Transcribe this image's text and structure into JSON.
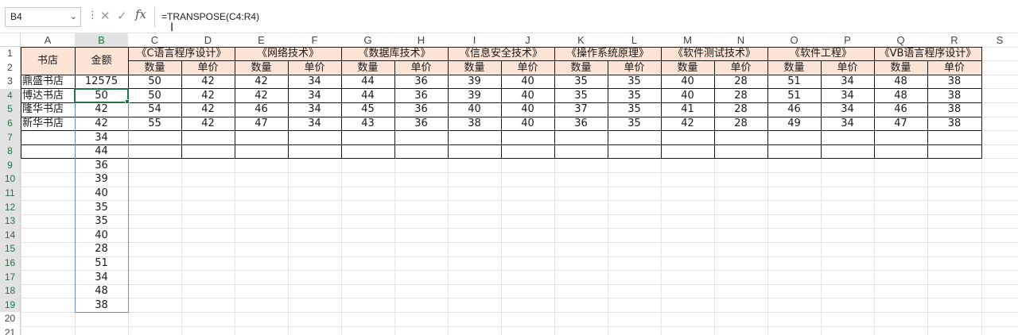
{
  "formula_bar": {
    "name_box": "B4",
    "formula": "=TRANSPOSE(C4:R4)",
    "fx_label": "fx",
    "cancel_icon": "close-icon",
    "confirm_icon": "check-icon"
  },
  "columns": [
    "A",
    "B",
    "C",
    "D",
    "E",
    "F",
    "G",
    "H",
    "I",
    "J",
    "K",
    "L",
    "M",
    "N",
    "O",
    "P",
    "Q",
    "R",
    "S"
  ],
  "row_numbers": [
    "1",
    "2",
    "3",
    "4",
    "5",
    "6",
    "7",
    "8",
    "9",
    "10",
    "11",
    "12",
    "13",
    "14",
    "15",
    "16",
    "17",
    "18",
    "19",
    "20",
    "21"
  ],
  "headers": {
    "store": "书店",
    "amount": "金额",
    "books": [
      "《C语言程序设计》",
      "《网络技术》",
      "《数据库技术》",
      "《信息安全技术》",
      "《操作系统原理》",
      "《软件测试技术》",
      "《软件工程》",
      "《VB语言程序设计》"
    ],
    "qty": "数量",
    "price": "单价"
  },
  "stores": [
    "鼎盛书店",
    "博达书店",
    "隆华书店",
    "新华书店"
  ],
  "amount_column": [
    "12575",
    "50",
    "42",
    "42",
    "34",
    "44",
    "36",
    "39",
    "40",
    "35",
    "35",
    "40",
    "28",
    "51",
    "34",
    "48",
    "38"
  ],
  "table_rows": [
    [
      "50",
      "42",
      "42",
      "34",
      "44",
      "36",
      "39",
      "40",
      "35",
      "35",
      "40",
      "28",
      "51",
      "34",
      "48",
      "38"
    ],
    [
      "50",
      "42",
      "42",
      "34",
      "44",
      "36",
      "39",
      "40",
      "35",
      "35",
      "40",
      "28",
      "51",
      "34",
      "48",
      "38"
    ],
    [
      "54",
      "42",
      "46",
      "34",
      "45",
      "36",
      "40",
      "40",
      "37",
      "35",
      "41",
      "28",
      "46",
      "34",
      "46",
      "38"
    ],
    [
      "55",
      "42",
      "47",
      "34",
      "43",
      "36",
      "38",
      "40",
      "36",
      "35",
      "42",
      "28",
      "49",
      "34",
      "47",
      "38"
    ]
  ],
  "colors": {
    "header_fill": "#fbe4d6",
    "active_border": "#217346",
    "spill_border": "#5b8fd0"
  }
}
